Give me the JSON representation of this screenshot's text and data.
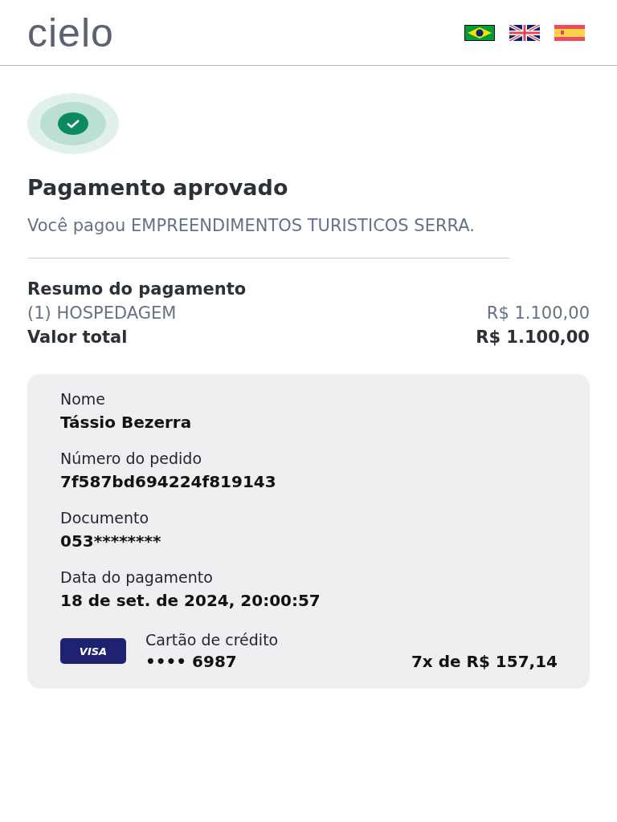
{
  "header": {
    "logo": "cielo",
    "languages": [
      {
        "kind": "br"
      },
      {
        "kind": "uk"
      },
      {
        "kind": "es"
      }
    ]
  },
  "status": {
    "title": "Pagamento aprovado",
    "message": "Você pagou EMPREENDIMENTOS TURISTICOS SERRA."
  },
  "summary": {
    "title": "Resumo do pagamento",
    "items": [
      {
        "label": "(1) HOSPEDAGEM",
        "amount": "R$ 1.100,00"
      }
    ],
    "total_label": "Valor total",
    "total_amount": "R$ 1.100,00"
  },
  "details": [
    {
      "label": "Nome",
      "value": "Tássio Bezerra"
    },
    {
      "label": "Número do pedido",
      "value": "7f587bd694224f819143"
    },
    {
      "label": "Documento",
      "value": "053********"
    },
    {
      "label": "Data do pagamento",
      "value": "18 de set. de 2024, 20:00:57"
    }
  ],
  "payment": {
    "brand": "VISA",
    "method": "Cartão de crédito",
    "card": "•••• 6987",
    "installments": "7x de R$ 157,14"
  }
}
